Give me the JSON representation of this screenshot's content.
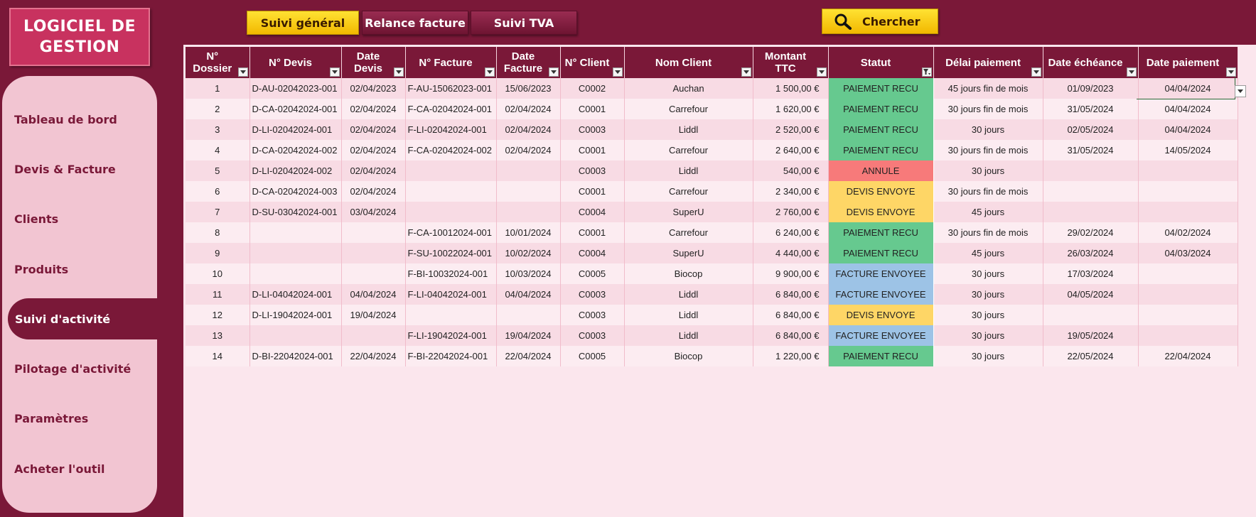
{
  "app": {
    "logo": "LOGICIEL DE GESTION"
  },
  "sidebar": {
    "items": [
      {
        "label": "Tableau de bord",
        "active": false
      },
      {
        "label": "Devis & Facture",
        "active": false
      },
      {
        "label": "Clients",
        "active": false
      },
      {
        "label": "Produits",
        "active": false
      },
      {
        "label": "Suivi d'activité",
        "active": true
      },
      {
        "label": "Pilotage d'activité",
        "active": false
      },
      {
        "label": "Paramètres",
        "active": false
      },
      {
        "label": "Acheter l'outil",
        "active": false
      }
    ]
  },
  "tabs": [
    {
      "label": "Suivi général",
      "active": true
    },
    {
      "label": "Relance facture",
      "active": false
    },
    {
      "label": "Suivi TVA",
      "active": false
    }
  ],
  "search": {
    "label": "Chercher",
    "icon": "search-icon"
  },
  "colors": {
    "primary": "#7a1838",
    "accent": "#f9cf0b",
    "paid": "#66c98f",
    "cancelled": "#f77a7a",
    "quote_sent": "#fed666",
    "invoice_sent": "#9dc3e6"
  },
  "table": {
    "columns": [
      "N° Dossier",
      "N° Devis",
      "Date Devis",
      "N° Facture",
      "Date Facture",
      "N° Client",
      "Nom Client",
      "Montant TTC",
      "Statut",
      "Délai paiement",
      "Date échéance",
      "Date paiement"
    ],
    "rows": [
      [
        "1",
        "D-AU-02042023-001",
        "02/04/2023",
        "F-AU-15062023-001",
        "15/06/2023",
        "C0002",
        "Auchan",
        "1 500,00 €",
        "PAIEMENT RECU",
        "45 jours fin de mois",
        "01/09/2023",
        "04/04/2024"
      ],
      [
        "2",
        "D-CA-02042024-001",
        "02/04/2024",
        "F-CA-02042024-001",
        "02/04/2024",
        "C0001",
        "Carrefour",
        "1 620,00 €",
        "PAIEMENT RECU",
        "30 jours fin de mois",
        "31/05/2024",
        "04/04/2024"
      ],
      [
        "3",
        "D-LI-02042024-001",
        "02/04/2024",
        "F-LI-02042024-001",
        "02/04/2024",
        "C0003",
        "Liddl",
        "2 520,00 €",
        "PAIEMENT RECU",
        "30 jours",
        "02/05/2024",
        "04/04/2024"
      ],
      [
        "4",
        "D-CA-02042024-002",
        "02/04/2024",
        "F-CA-02042024-002",
        "02/04/2024",
        "C0001",
        "Carrefour",
        "2 640,00 €",
        "PAIEMENT RECU",
        "30 jours fin de mois",
        "31/05/2024",
        "14/05/2024"
      ],
      [
        "5",
        "D-LI-02042024-002",
        "02/04/2024",
        "",
        "",
        "C0003",
        "Liddl",
        "540,00 €",
        "ANNULE",
        "30 jours",
        "",
        ""
      ],
      [
        "6",
        "D-CA-02042024-003",
        "02/04/2024",
        "",
        "",
        "C0001",
        "Carrefour",
        "2 340,00 €",
        "DEVIS ENVOYE",
        "30 jours fin de mois",
        "",
        ""
      ],
      [
        "7",
        "D-SU-03042024-001",
        "03/04/2024",
        "",
        "",
        "C0004",
        "SuperU",
        "2 760,00 €",
        "DEVIS ENVOYE",
        "45 jours",
        "",
        ""
      ],
      [
        "8",
        "",
        "",
        "F-CA-10012024-001",
        "10/01/2024",
        "C0001",
        "Carrefour",
        "6 240,00 €",
        "PAIEMENT RECU",
        "30 jours fin de mois",
        "29/02/2024",
        "04/02/2024"
      ],
      [
        "9",
        "",
        "",
        "F-SU-10022024-001",
        "10/02/2024",
        "C0004",
        "SuperU",
        "4 440,00 €",
        "PAIEMENT RECU",
        "45 jours",
        "26/03/2024",
        "04/03/2024"
      ],
      [
        "10",
        "",
        "",
        "F-BI-10032024-001",
        "10/03/2024",
        "C0005",
        "Biocop",
        "9 900,00 €",
        "FACTURE ENVOYEE",
        "30 jours",
        "17/03/2024",
        ""
      ],
      [
        "11",
        "D-LI-04042024-001",
        "04/04/2024",
        "F-LI-04042024-001",
        "04/04/2024",
        "C0003",
        "Liddl",
        "6 840,00 €",
        "FACTURE ENVOYEE",
        "30 jours",
        "04/05/2024",
        ""
      ],
      [
        "12",
        "D-LI-19042024-001",
        "19/04/2024",
        "",
        "",
        "C0003",
        "Liddl",
        "6 840,00 €",
        "DEVIS ENVOYE",
        "30 jours",
        "",
        ""
      ],
      [
        "13",
        "",
        "",
        "F-LI-19042024-001",
        "19/04/2024",
        "C0003",
        "Liddl",
        "6 840,00 €",
        "FACTURE ENVOYEE",
        "30 jours",
        "19/05/2024",
        ""
      ],
      [
        "14",
        "D-BI-22042024-001",
        "22/04/2024",
        "F-BI-22042024-001",
        "22/04/2024",
        "C0005",
        "Biocop",
        "1 220,00 €",
        "PAIEMENT RECU",
        "30 jours",
        "22/05/2024",
        "22/04/2024"
      ]
    ]
  }
}
